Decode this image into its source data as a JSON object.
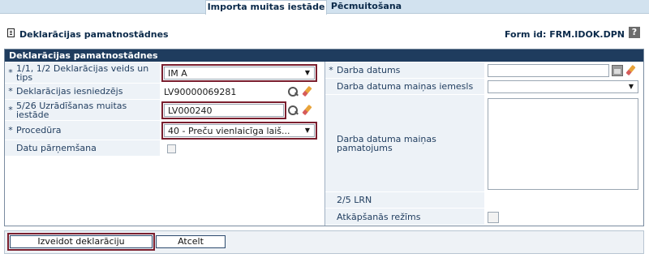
{
  "tabs": [
    {
      "label": "Importa muitas iestāde",
      "active": true
    },
    {
      "label": "Pēcmuitošana",
      "active": false
    }
  ],
  "header": {
    "title": "Deklarācijas pamatnostādnes",
    "form_id": "Form id: FRM.IDOK.DPN",
    "help": "?"
  },
  "panel": {
    "title": "Deklarācijas pamatnostādnes",
    "left_fields": {
      "decl_type": {
        "required": "*",
        "label": "1/1, 1/2 Deklarācijas veids un tips",
        "value": "IM A"
      },
      "declarant": {
        "required": "*",
        "label": "Deklarācijas iesniedzējs",
        "value": "LV90000069281"
      },
      "customs_office": {
        "required": "*",
        "label": "5/26 Uzrādīšanas muitas iestāde",
        "value": "LV000240"
      },
      "procedure": {
        "required": "*",
        "label": "Procedūra",
        "value": "40 - Preču vienlaicīga laiš..."
      },
      "data_takeover": {
        "label": "Datu pārņemšana"
      }
    },
    "right_fields": {
      "work_date": {
        "required": "*",
        "label": "Darba datums",
        "value": ""
      },
      "date_change_reason": {
        "label": "Darba datuma maiņas iemesls",
        "value": ""
      },
      "date_change_justification": {
        "label": "Darba datuma maiņas pamatojums",
        "value": ""
      },
      "lrn": {
        "label": "2/5 LRN",
        "value": ""
      },
      "fallback_mode": {
        "label": "Atkāpšanās režīms"
      }
    }
  },
  "buttons": {
    "create": "Izveidot deklarāciju",
    "cancel": "Atcelt"
  },
  "colors": {
    "panel_header": "#1f3c5e",
    "label_bg": "#edf2f7",
    "highlight": "#7a1e2e"
  }
}
